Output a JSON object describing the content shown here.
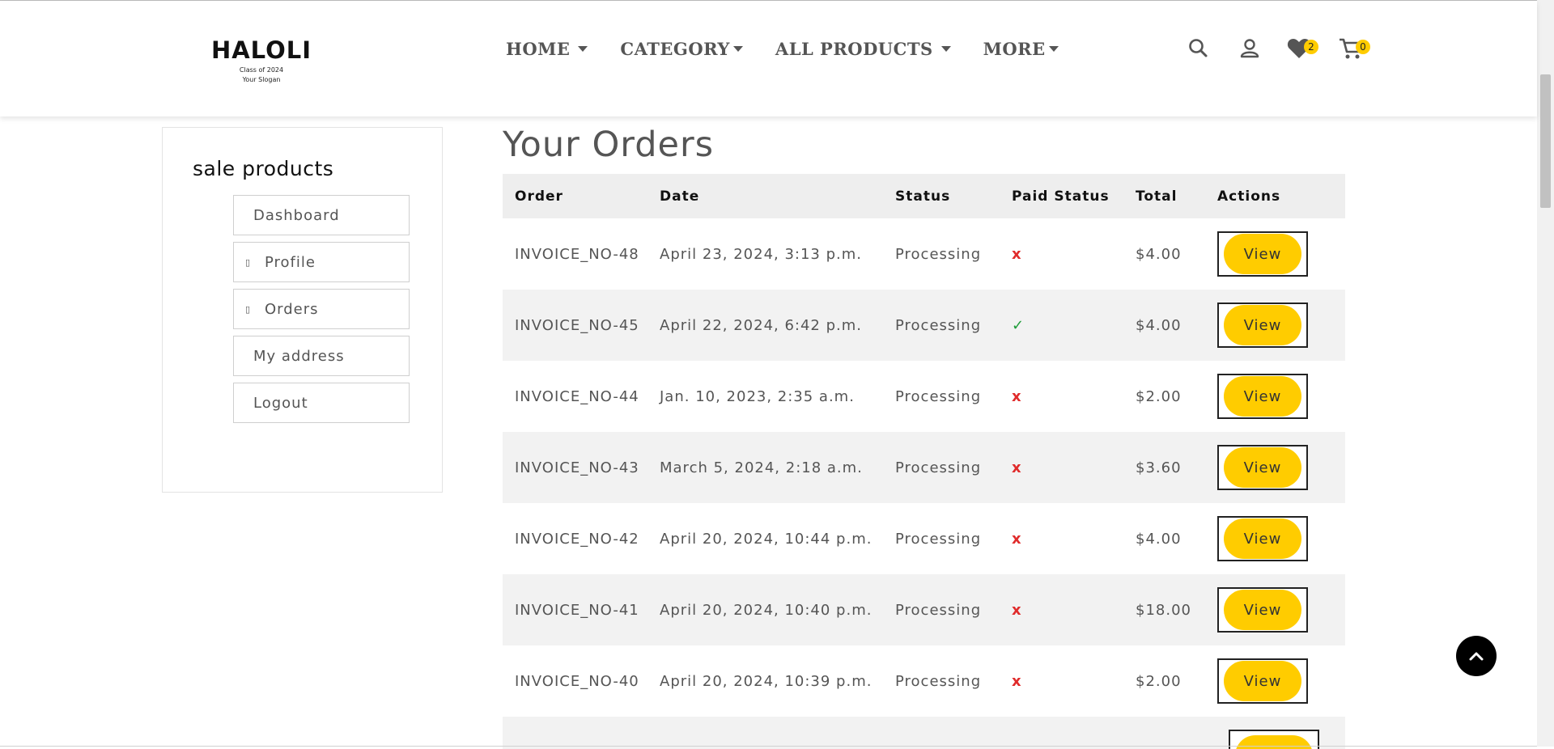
{
  "brand": {
    "name": "HALOLI",
    "line1": "Class of 2024",
    "line2": "Your Slogan"
  },
  "nav": [
    {
      "label": "HOME"
    },
    {
      "label": "CATEGORY"
    },
    {
      "label": "ALL PRODUCTS"
    },
    {
      "label": "MORE"
    }
  ],
  "header_icons": {
    "wishlist_count": "2",
    "cart_count": "0"
  },
  "sidebar": {
    "title": "sale products",
    "items": [
      {
        "label": "Dashboard",
        "icon": ""
      },
      {
        "label": "Profile",
        "icon": "▯"
      },
      {
        "label": "Orders",
        "icon": "▯"
      },
      {
        "label": "My address",
        "icon": ""
      },
      {
        "label": "Logout",
        "icon": ""
      }
    ]
  },
  "page": {
    "title": "Your Orders"
  },
  "table": {
    "headers": {
      "order": "Order",
      "date": "Date",
      "status": "Status",
      "paid": "Paid Status",
      "total": "Total",
      "actions": "Actions"
    },
    "rows": [
      {
        "order": "INVOICE_NO-48",
        "date": "April 23, 2024, 3:13 p.m.",
        "status": "Processing",
        "paid": "x",
        "total": "$4.00",
        "action": "View"
      },
      {
        "order": "INVOICE_NO-45",
        "date": "April 22, 2024, 6:42 p.m.",
        "status": "Processing",
        "paid": "✓",
        "total": "$4.00",
        "action": "View"
      },
      {
        "order": "INVOICE_NO-44",
        "date": "Jan. 10, 2023, 2:35 a.m.",
        "status": "Processing",
        "paid": "x",
        "total": "$2.00",
        "action": "View"
      },
      {
        "order": "INVOICE_NO-43",
        "date": "March 5, 2024, 2:18 a.m.",
        "status": "Processing",
        "paid": "x",
        "total": "$3.60",
        "action": "View"
      },
      {
        "order": "INVOICE_NO-42",
        "date": "April 20, 2024, 10:44 p.m.",
        "status": "Processing",
        "paid": "x",
        "total": "$4.00",
        "action": "View"
      },
      {
        "order": "INVOICE_NO-41",
        "date": "April 20, 2024, 10:40 p.m.",
        "status": "Processing",
        "paid": "x",
        "total": "$18.00",
        "action": "View"
      },
      {
        "order": "INVOICE_NO-40",
        "date": "April 20, 2024, 10:39 p.m.",
        "status": "Processing",
        "paid": "x",
        "total": "$2.00",
        "action": "View"
      }
    ]
  },
  "colors": {
    "accent": "#ffcc00",
    "unpaid": "#e02b2b",
    "paid": "#1f9d3a"
  }
}
